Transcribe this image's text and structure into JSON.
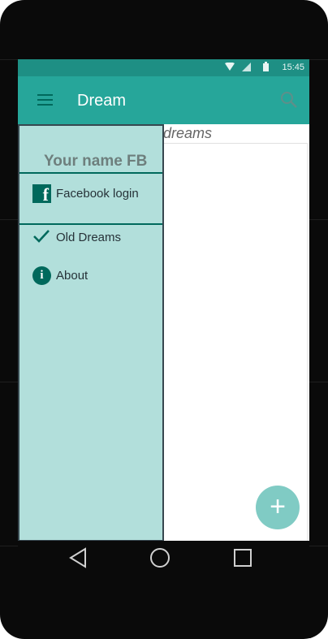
{
  "status_bar": {
    "time": "15:45",
    "wifi_icon": "wifi-icon",
    "signal_icon": "signal-icon",
    "battery_icon": "battery-icon"
  },
  "app_bar": {
    "title": "Dream",
    "menu_icon": "menu-icon",
    "search_icon": "search-icon"
  },
  "content": {
    "hint_text": "ur dreams",
    "fab_icon": "plus-icon",
    "fab_label": "+"
  },
  "drawer": {
    "user_name": "Your name FB",
    "items": [
      {
        "label": "Facebook login",
        "icon": "facebook-icon",
        "icon_glyph": "f"
      },
      {
        "label": "Old Dreams",
        "icon": "checkmark-icon"
      },
      {
        "label": "About",
        "icon": "info-icon",
        "icon_glyph": "i"
      }
    ]
  },
  "nav_bar": {
    "back_icon": "back-icon",
    "home_icon": "home-icon",
    "recents_icon": "recents-icon"
  },
  "colors": {
    "primary": "#26a69a",
    "primary_dark": "#1e8f84",
    "drawer_bg": "#b2dfdb",
    "accent_dark": "#00695c",
    "fab": "#80cbc4"
  }
}
